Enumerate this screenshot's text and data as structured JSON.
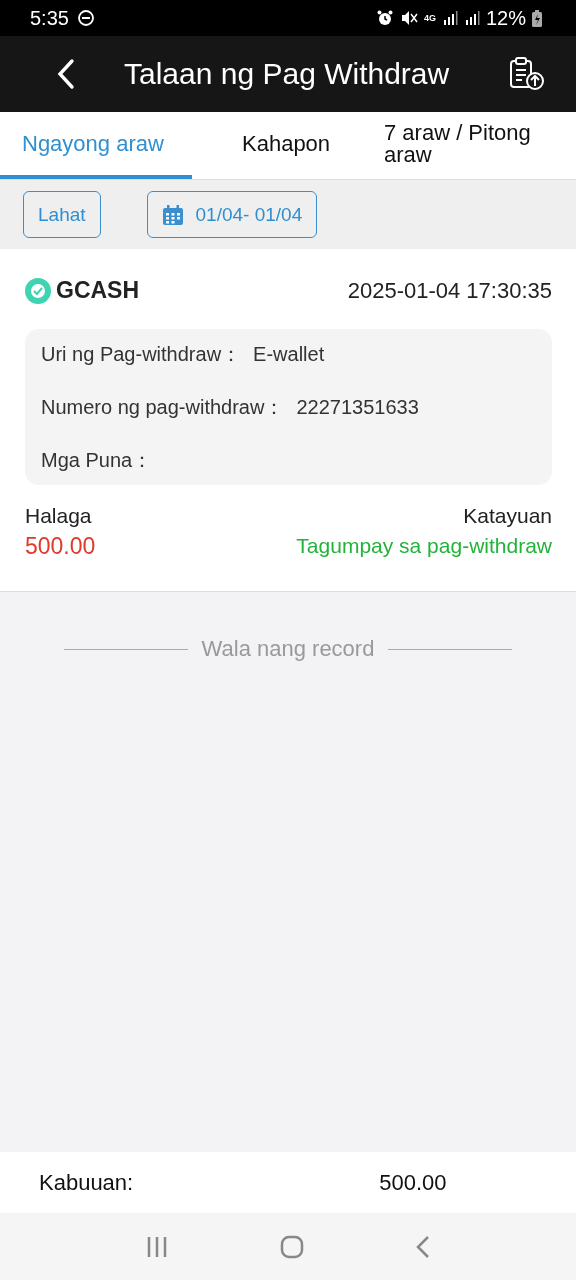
{
  "status_bar": {
    "time": "5:35",
    "network": "4G",
    "battery": "12%"
  },
  "header": {
    "title": "Talaan ng Pag Withdraw"
  },
  "tabs": [
    {
      "label": "Ngayong araw",
      "selected": true
    },
    {
      "label": "Kahapon",
      "selected": false
    },
    {
      "label": "7 araw / Pitong araw",
      "selected": false
    }
  ],
  "filters": {
    "all": "Lahat",
    "date_range": "01/04- 01/04"
  },
  "records": [
    {
      "method": "GCASH",
      "time": "2025-01-04 17:30:35",
      "details": [
        {
          "label": "Uri ng Pag-withdraw：",
          "value": "E-wallet"
        },
        {
          "label": "Numero ng pag-withdraw：",
          "value": "22271351633"
        },
        {
          "label": "Mga Puna："
        }
      ],
      "amount_label": "Halaga",
      "amount": "500.00",
      "status_label": "Katayuan",
      "status": "Tagumpay sa pag-withdraw",
      "kind": "success"
    }
  ],
  "end_note": "Wala nang record",
  "total": {
    "label": "Kabuuan:",
    "value": "500.00"
  }
}
